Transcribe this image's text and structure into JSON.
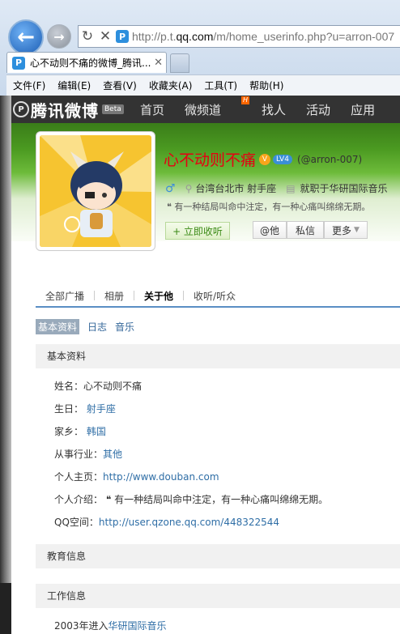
{
  "browser": {
    "url_prefix": "http://p.t.",
    "url_domain": "qq.com",
    "url_rest": "/m/home_userinfo.php?u=arron-007",
    "tab_title": "心不动则不痛的微博_腾讯...",
    "menu": [
      "文件(F)",
      "编辑(E)",
      "查看(V)",
      "收藏夹(A)",
      "工具(T)",
      "帮助(H)"
    ]
  },
  "site": {
    "logo_text": "腾讯微博",
    "beta": "Beta",
    "nav": [
      "首页",
      "微频道",
      "找人",
      "活动",
      "应用"
    ],
    "hot_badge": "H"
  },
  "profile": {
    "name": "心不动则不痛",
    "level": "LV4",
    "account": "(@arron-007)",
    "location": "台湾台北市 射手座",
    "job": "就职于华研国际音乐",
    "motto": "有一种结局叫命中注定，有一种心痛叫绵绵无期。",
    "listen_btn": "+ 立即收听",
    "at_btn": "@他",
    "msg_btn": "私信",
    "more_btn": "更多"
  },
  "tabs": [
    "全部广播",
    "相册",
    "关于他",
    "收听/听众"
  ],
  "subtabs": [
    "基本资料",
    "日志",
    "音乐"
  ],
  "sections": {
    "basic": "基本资料",
    "edu": "教育信息",
    "work": "工作信息"
  },
  "info": {
    "name_label": "姓名：",
    "name_value": "心不动则不痛",
    "birthday_label": "生日：",
    "birthday_value": "射手座",
    "hometown_label": "家乡：",
    "hometown_value": "韩国",
    "industry_label": "从事行业：",
    "industry_value": "其他",
    "homepage_label": "个人主页：",
    "homepage_value": "http://www.douban.com",
    "intro_label": "个人介绍：",
    "intro_value": "有一种结局叫命中注定，有一种心痛叫绵绵无期。",
    "qzone_label": "QQ空间：",
    "qzone_value": "http://user.qzone.qq.com/448322544"
  },
  "work": {
    "year_text": "2003年进入",
    "company": "华研国际音乐"
  }
}
